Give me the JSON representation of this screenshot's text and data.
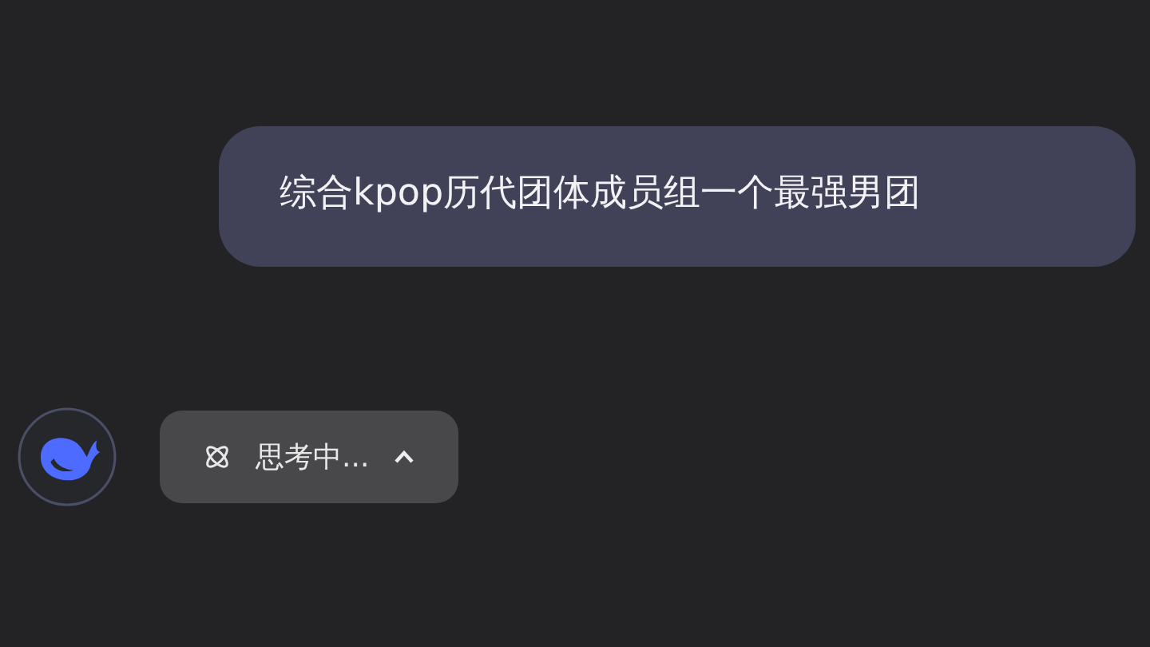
{
  "messages": [
    {
      "kind": "user",
      "text": "综合kpop历代团体成员组一个最强男团"
    },
    {
      "kind": "thinking",
      "text": "思考中...",
      "expanded": true
    }
  ]
}
